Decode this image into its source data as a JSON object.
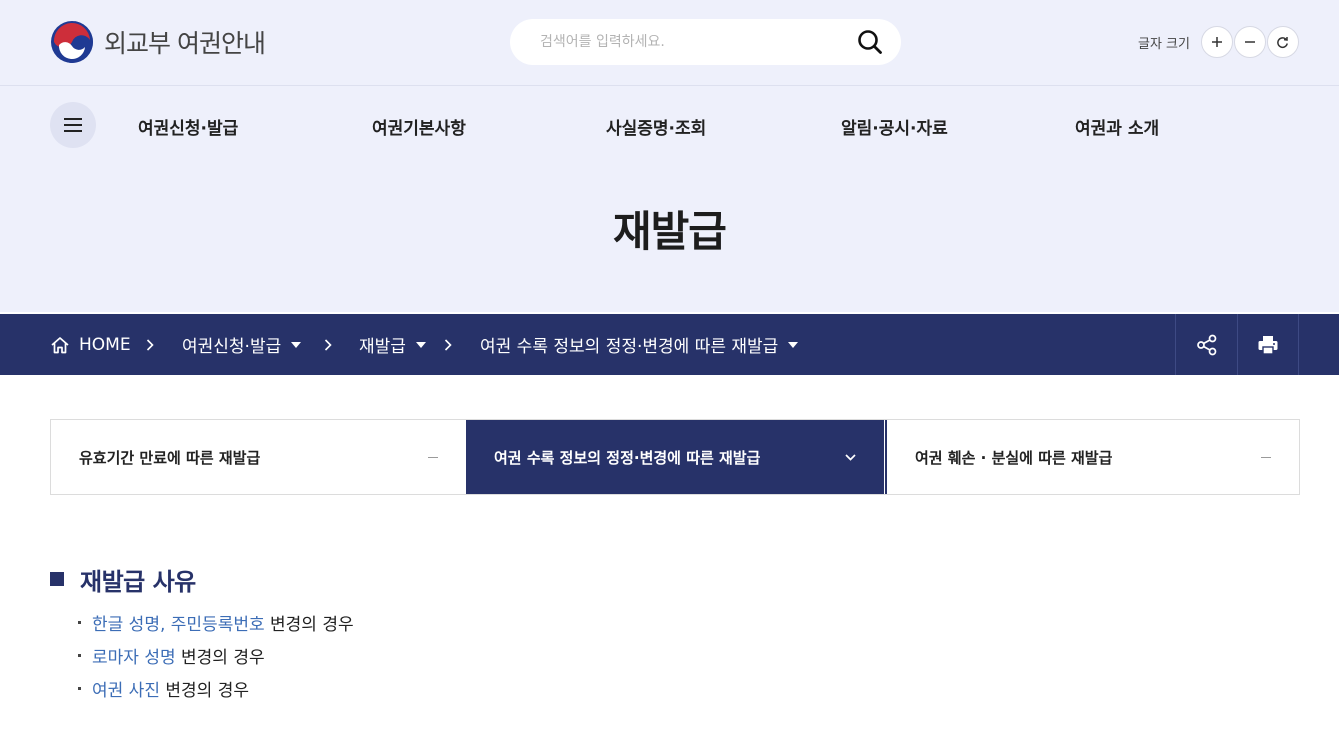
{
  "brand": {
    "name": "외교부 여권안내"
  },
  "search": {
    "placeholder": "검색어를 입력하세요."
  },
  "font_size": {
    "label": "글자 크기"
  },
  "gnb": [
    "여권신청·발급",
    "여권기본사항",
    "사실증명·조회",
    "알림·공시·자료",
    "여권과 소개"
  ],
  "page_title": "재발급",
  "breadcrumb": [
    "HOME",
    "여권신청·발급",
    "재발급",
    "여권 수록 정보의 정정·변경에 따른 재발급"
  ],
  "tabs": [
    {
      "label": "유효기간 만료에 따른 재발급",
      "active": false
    },
    {
      "label": "여권 수록 정보의 정정·변경에 따른 재발급",
      "active": true
    },
    {
      "label": "여권 훼손 · 분실에 따른 재발급",
      "active": false
    }
  ],
  "section": {
    "title": "재발급 사유",
    "items": [
      {
        "link": "한글 성명, 주민등록번호",
        "suffix": "변경의 경우"
      },
      {
        "link": "로마자 성명",
        "suffix": "변경의 경우"
      },
      {
        "link": "여권 사진",
        "suffix": "변경의 경우"
      }
    ]
  },
  "colors": {
    "navy": "#273269",
    "top_bg": "#eef0fb",
    "link": "#3c6db6",
    "emblem_red": "#cd2e3a",
    "emblem_blue": "#1f3a93"
  }
}
